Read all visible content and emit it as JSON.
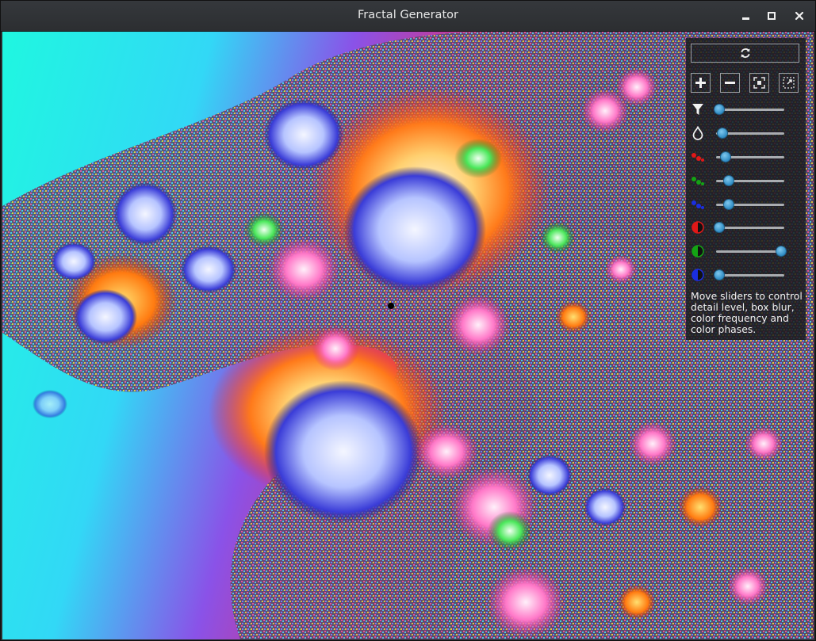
{
  "window": {
    "title": "Fractal Generator",
    "minimize_label": "Minimize",
    "maximize_label": "Maximize",
    "close_label": "Close"
  },
  "panel": {
    "refresh_icon": "refresh-icon",
    "tools": [
      {
        "name": "zoom-in-icon"
      },
      {
        "name": "zoom-out-icon"
      },
      {
        "name": "zoom-fit-icon"
      },
      {
        "name": "zoom-selection-icon"
      }
    ],
    "sliders": [
      {
        "name": "detail-level",
        "icon": "funnel-icon",
        "value": 0.0
      },
      {
        "name": "box-blur",
        "icon": "drop-icon",
        "value": 0.05
      },
      {
        "name": "red-frequency",
        "icon": "red-dots-icon",
        "value": 0.1
      },
      {
        "name": "green-frequency",
        "icon": "green-dots-icon",
        "value": 0.15
      },
      {
        "name": "blue-frequency",
        "icon": "blue-dots-icon",
        "value": 0.15
      },
      {
        "name": "red-phase",
        "icon": "red-half-circle-icon",
        "value": 0.0
      },
      {
        "name": "green-phase",
        "icon": "green-half-circle-icon",
        "value": 1.0
      },
      {
        "name": "blue-phase",
        "icon": "blue-half-circle-icon",
        "value": 0.0
      }
    ],
    "help_text": "Move sliders to control\ndetail level, box blur,\ncolor frequency and\ncolor phases."
  },
  "colors": {
    "red": "#e01818",
    "green": "#14a314",
    "blue": "#1a2ee0",
    "slider_knob": "#3d97cf"
  }
}
